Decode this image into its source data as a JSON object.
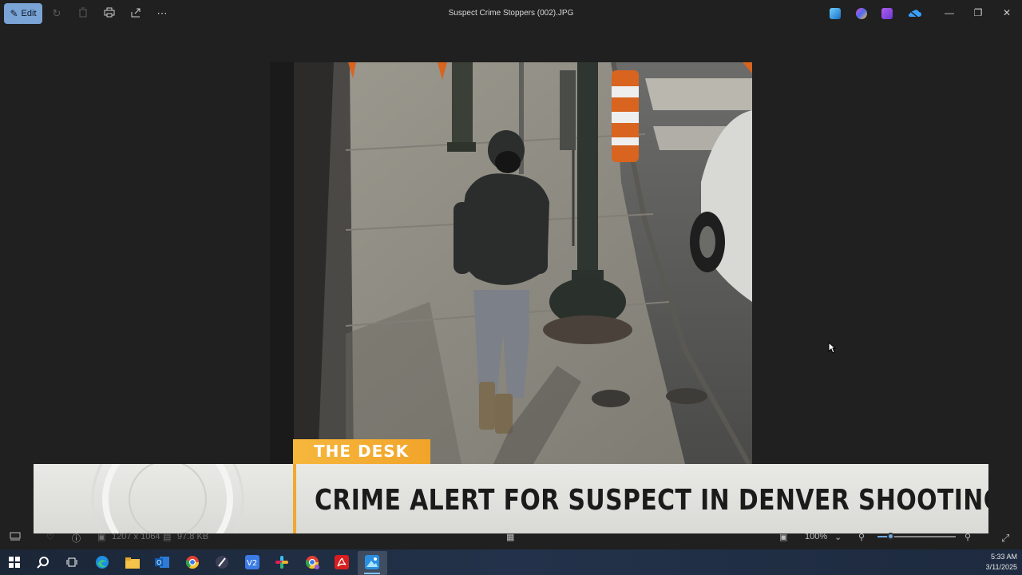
{
  "window": {
    "title": "Suspect Crime Stoppers (002).JPG",
    "edit_label": "Edit"
  },
  "toolbar": {
    "icons": [
      "edit-icon",
      "rotate-icon",
      "delete-icon",
      "print-icon",
      "share-icon",
      "more-icon"
    ]
  },
  "app_icons": [
    "photos-icon",
    "copilot-icon",
    "clipchamp-icon",
    "onedrive-icon"
  ],
  "overlay": {
    "tag": "THE DESK",
    "headline": "CRIME ALERT FOR SUSPECT IN DENVER SHOOTING"
  },
  "status": {
    "dimensions": "1207 x 1064",
    "size": "97.8 KB",
    "zoom": "100%",
    "zoom_fraction": 0.17
  },
  "taskbar": {
    "apps": [
      "windows-start-icon",
      "search-icon",
      "task-view-icon",
      "edge-icon",
      "file-explorer-icon",
      "outlook-icon",
      "chrome-icon",
      "app-icon",
      "vz-icon",
      "slack-icon",
      "chrome-alt-icon",
      "acrobat-icon",
      "photos-icon"
    ]
  },
  "clock": {
    "time": "5:33 AM",
    "date": "3/11/2025"
  },
  "colors": {
    "accent": "#f0a830",
    "edit_button": "#7aa3d6"
  }
}
